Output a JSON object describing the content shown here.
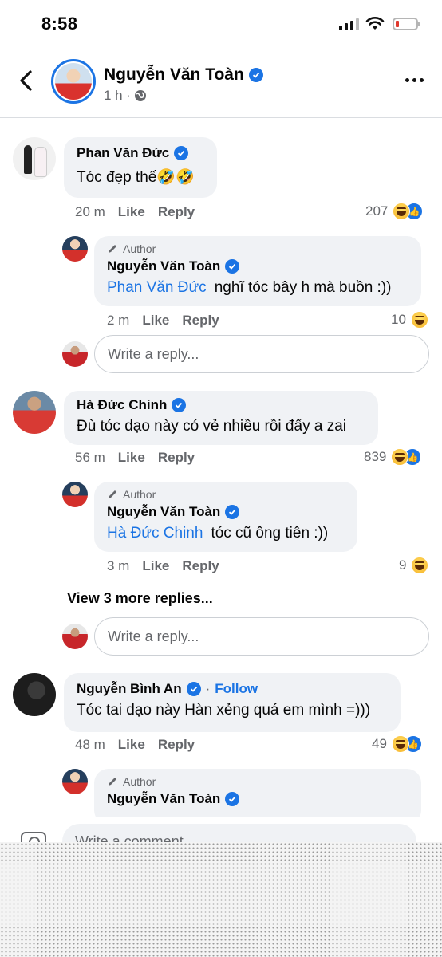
{
  "status_bar": {
    "time": "8:58"
  },
  "header": {
    "name": "Nguyễn Văn Toàn",
    "subtitle": "1 h ·"
  },
  "comments": [
    {
      "name": "Phan Văn Đức",
      "text": "Tóc đẹp thế🤣🤣",
      "time": "20 m",
      "like": "Like",
      "reply": "Reply",
      "reactions": "207",
      "reply_item": {
        "badge": "Author",
        "name": "Nguyễn Văn Toàn",
        "mention": "Phan Văn Đức",
        "text": "nghĩ tóc bây h mà buồn :))",
        "time": "2 m",
        "like": "Like",
        "reply": "Reply",
        "reactions": "10"
      },
      "reply_placeholder": "Write a reply..."
    },
    {
      "name": "Hà Đức Chinh",
      "text": "Đù tóc dạo này có vẻ nhiều rồi đấy a zai",
      "time": "56 m",
      "like": "Like",
      "reply": "Reply",
      "reactions": "839",
      "reply_item": {
        "badge": "Author",
        "name": "Nguyễn Văn Toàn",
        "mention": "Hà Đức Chinh",
        "text": "tóc cũ ông tiên :))",
        "time": "3 m",
        "like": "Like",
        "reply": "Reply",
        "reactions": "9"
      },
      "view_more": "View 3 more replies...",
      "reply_placeholder": "Write a reply..."
    },
    {
      "name": "Nguyễn Bình An",
      "follow": "Follow",
      "text": "Tóc tai dạo này Hàn xẻng quá em mình =)))",
      "time": "48 m",
      "like": "Like",
      "reply": "Reply",
      "reactions": "49",
      "reply_item": {
        "badge": "Author",
        "name": "Nguyễn Văn Toàn"
      }
    }
  ],
  "composer": {
    "placeholder": "Write a comment..."
  },
  "colors": {
    "accent": "#1b74e4",
    "bubble": "#f0f2f5",
    "muted": "#65676b"
  }
}
